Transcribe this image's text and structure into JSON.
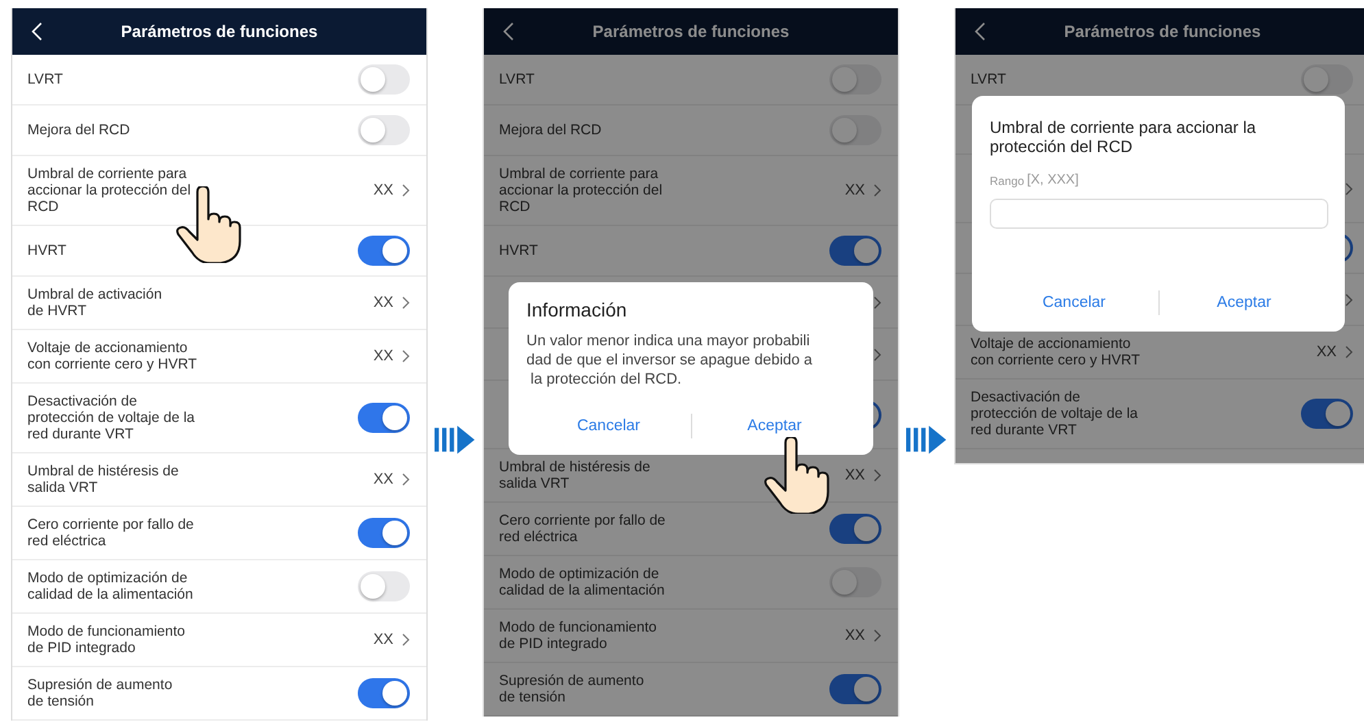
{
  "screens": [
    {
      "header": {
        "title": "Parámetros de funciones"
      },
      "dimmed": false,
      "rows": [
        {
          "kind": "toggle",
          "label": "LVRT",
          "on": false
        },
        {
          "kind": "toggle",
          "label": "Mejora del RCD",
          "on": false
        },
        {
          "kind": "value",
          "label": "Umbral de corriente para\naccionar la protección del\nRCD",
          "value": "XX",
          "tapped": true
        },
        {
          "kind": "toggle",
          "label": "HVRT",
          "on": true
        },
        {
          "kind": "value",
          "label": "Umbral de activación\nde HVRT",
          "value": "XX"
        },
        {
          "kind": "value",
          "label": "Voltaje de accionamiento\ncon corriente cero y HVRT",
          "value": "XX"
        },
        {
          "kind": "toggle",
          "label": "Desactivación de\nprotección de voltaje de la\nred durante VRT",
          "on": true
        },
        {
          "kind": "value",
          "label": "Umbral de histéresis de\nsalida VRT",
          "value": "XX"
        },
        {
          "kind": "toggle",
          "label": "Cero corriente por fallo de\nred eléctrica",
          "on": true
        },
        {
          "kind": "toggle",
          "label": "Modo de optimización de\ncalidad de la alimentación",
          "on": false
        },
        {
          "kind": "value",
          "label": "Modo de funcionamiento\nde PID integrado",
          "value": "XX"
        },
        {
          "kind": "toggle",
          "label": "Supresión de aumento\nde tensión",
          "on": true
        }
      ]
    },
    {
      "header": {
        "title": "Parámetros de funciones"
      },
      "dimmed": true,
      "rows": [
        {
          "kind": "toggle",
          "label": "LVRT",
          "on": false
        },
        {
          "kind": "toggle",
          "label": "Mejora del RCD",
          "on": false
        },
        {
          "kind": "value",
          "label": "Umbral de corriente para\naccionar la protección del\nRCD",
          "value": "XX"
        },
        {
          "kind": "toggle",
          "label": "HVRT",
          "on": true
        },
        {
          "kind": "value"
        },
        {
          "kind": "value"
        },
        {
          "kind": "toggle",
          "on": true
        },
        {
          "kind": "value",
          "label": "Umbral de histéresis de\nsalida VRT",
          "value": "XX"
        },
        {
          "kind": "toggle",
          "label": "Cero corriente por fallo de\nred eléctrica",
          "on": true
        },
        {
          "kind": "toggle",
          "label": "Modo de optimización de\ncalidad de la alimentación",
          "on": false
        },
        {
          "kind": "value",
          "label": "Modo de funcionamiento\nde PID integrado",
          "value": "XX"
        },
        {
          "kind": "toggle",
          "label": "Supresión de aumento\nde tensión",
          "on": true
        }
      ],
      "dialog": {
        "kind": "info",
        "title": "Información",
        "message": "Un valor menor indica una mayor probabili\ndad de que el inversor se apague debido a\n la protección del RCD.",
        "buttons": [
          {
            "label": "Cancelar"
          },
          {
            "label": "Aceptar",
            "tapped": true
          }
        ]
      }
    },
    {
      "header": {
        "title": "Parámetros de funciones"
      },
      "dimmed": true,
      "cut": true,
      "rows": [
        {
          "kind": "toggle",
          "label": "LVRT",
          "on": false
        },
        {
          "kind": "toggle"
        },
        {
          "kind": "value"
        },
        {
          "kind": "toggle",
          "on": true
        },
        {
          "kind": "value"
        },
        {
          "kind": "value",
          "label": "Voltaje de accionamiento\ncon corriente cero y HVRT",
          "value": "XX"
        },
        {
          "kind": "toggle",
          "label": "Desactivación de\nprotección de voltaje de la\nred durante VRT",
          "on": true
        }
      ],
      "dialog": {
        "kind": "input",
        "title": "Umbral de corriente para accionar la\nprotección del RCD",
        "range_label": "Rango",
        "range_value": "[X, XXX]",
        "buttons": [
          {
            "label": "Cancelar"
          },
          {
            "label": "Aceptar"
          }
        ]
      }
    }
  ]
}
